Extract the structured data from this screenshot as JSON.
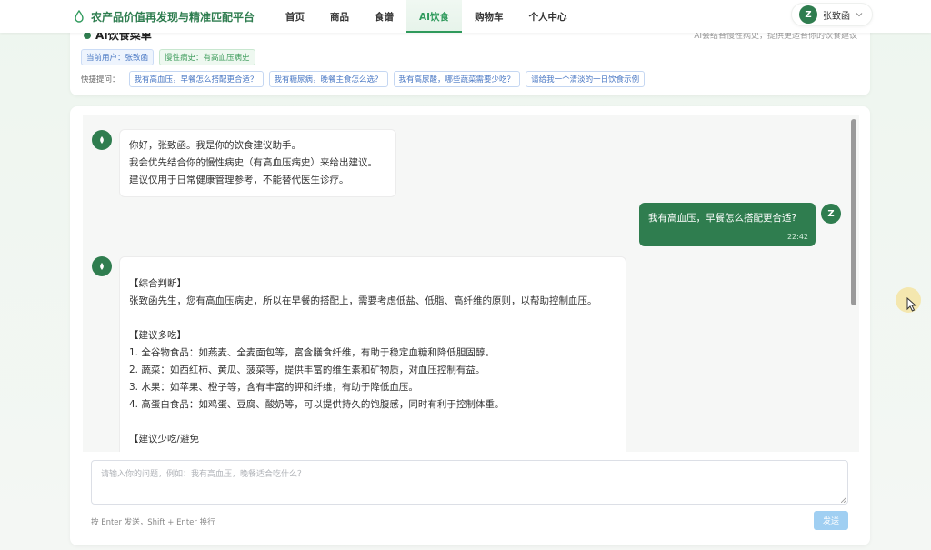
{
  "header": {
    "brand": "农产品价值再发现与精准匹配平台",
    "nav": [
      {
        "label": "首页"
      },
      {
        "label": "商品"
      },
      {
        "label": "食谱"
      },
      {
        "label": "AI饮食"
      },
      {
        "label": "购物车"
      },
      {
        "label": "个人中心"
      }
    ],
    "active_nav": "AI饮食",
    "user": {
      "initial": "Z",
      "name": "张致函"
    }
  },
  "info": {
    "title": "AI饮食菜单",
    "hint_right": "AI会结合慢性病史，提供更适合你的饮食建议",
    "current_user_tag": "当前用户：张致函",
    "chronic_tag": "慢性病史：有高血压病史",
    "quick_label": "快捷提问：",
    "quick_questions": [
      "我有高血压，早餐怎么搭配更合适？",
      "我有糖尿病，晚餐主食怎么选？",
      "我有高尿酸，哪些蔬菜需要少吃？",
      "请给我一个清淡的一日饮食示例"
    ]
  },
  "chat": {
    "bot_greeting": [
      "你好，张致函。我是你的饮食建议助手。",
      "我会优先结合你的慢性病史（有高血压病史）来给出建议。",
      "建议仅用于日常健康管理参考，不能替代医生诊疗。"
    ],
    "user_message": {
      "text": "我有高血压，早餐怎么搭配更合适?",
      "time": "22:42",
      "initial": "Z"
    },
    "bot_reply": {
      "section1_title": "【综合判断】",
      "section1_text": "张致函先生，您有高血压病史，所以在早餐的搭配上，需要考虑低盐、低脂、高纤维的原则，以帮助控制血压。",
      "section2_title": "【建议多吃】",
      "items": [
        "1. 全谷物食品：如燕麦、全麦面包等，富含膳食纤维，有助于稳定血糖和降低胆固醇。",
        "2. 蔬菜：如西红柿、黄瓜、菠菜等，提供丰富的维生素和矿物质，对血压控制有益。",
        "3. 水果：如苹果、橙子等，含有丰富的钾和纤维，有助于降低血压。",
        "4. 高蛋白食品：如鸡蛋、豆腐、酸奶等，可以提供持久的饱腹感，同时有利于控制体重。"
      ],
      "section3_title": "【建议少吃/避免"
    },
    "input_placeholder": "请输入你的问题，例如：我有高血压，晚餐适合吃什么？",
    "footer_hint": "按 Enter 发送，Shift + Enter 换行",
    "send_label": "发送"
  },
  "colors": {
    "brand_green": "#2f7d4f",
    "accent_green": "#2f9a5c",
    "link_blue": "#4a78c4",
    "send_disabled": "#a0cff2"
  }
}
